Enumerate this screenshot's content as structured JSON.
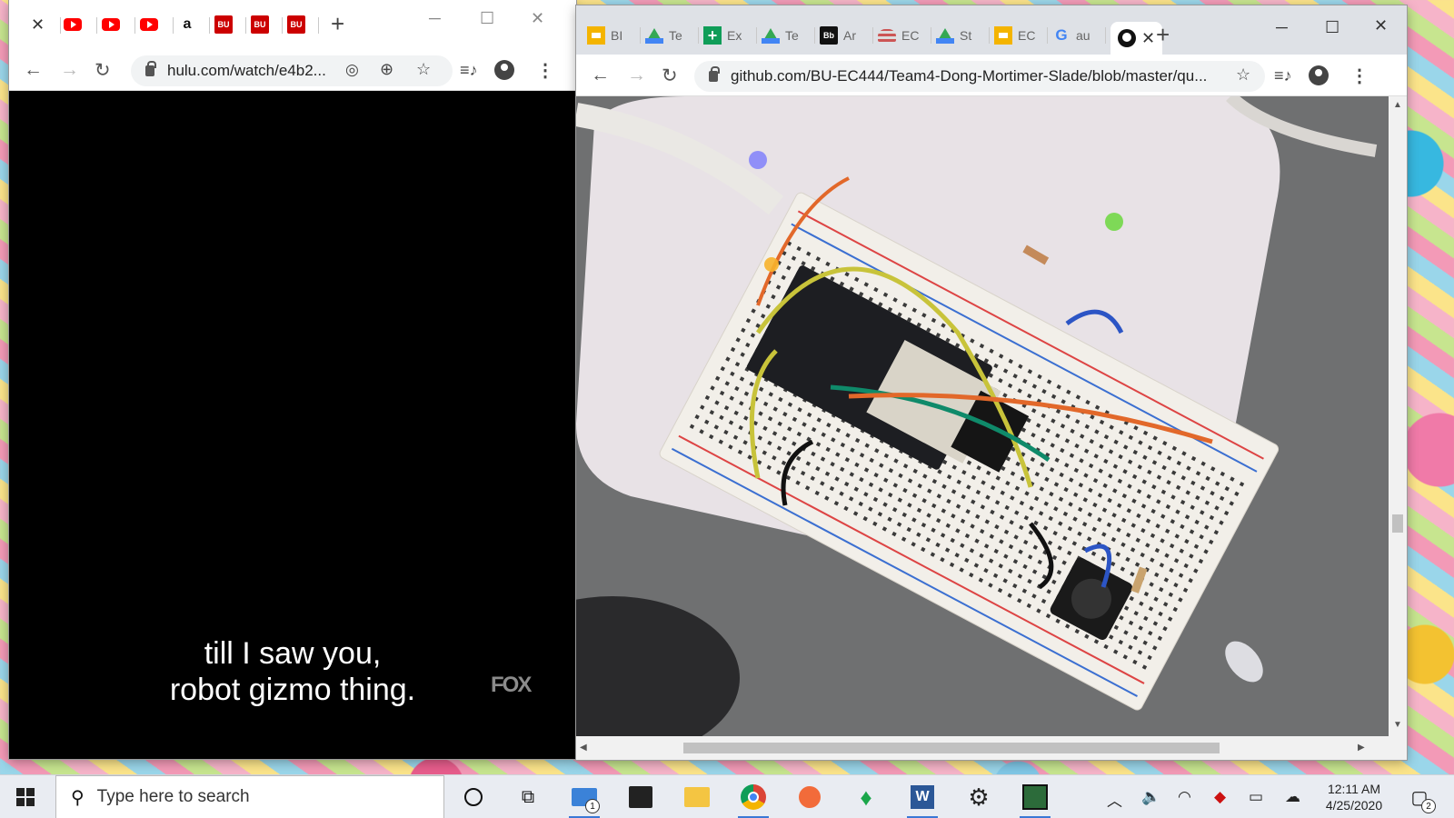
{
  "left_window": {
    "tabs": [
      {
        "icon": "close-icon",
        "kind": "close",
        "title": ""
      },
      {
        "icon": "youtube-icon",
        "kind": "yt",
        "title": ""
      },
      {
        "icon": "youtube-icon",
        "kind": "yt",
        "title": ""
      },
      {
        "icon": "youtube-icon",
        "kind": "yt",
        "title": ""
      },
      {
        "icon": "amazon-icon",
        "kind": "az",
        "title": ""
      },
      {
        "icon": "bu-icon",
        "kind": "bu",
        "title": ""
      },
      {
        "icon": "bu-icon",
        "kind": "bu",
        "title": ""
      },
      {
        "icon": "bu-icon",
        "kind": "bu",
        "title": ""
      }
    ],
    "url": "hulu.com/watch/e4b2...",
    "caption_line1": "till I saw you,",
    "caption_line2": "robot gizmo thing.",
    "logo_text": "FOX"
  },
  "right_window": {
    "tabs": [
      {
        "icon": "slides-icon",
        "kind": "slides",
        "title": "BІ"
      },
      {
        "icon": "drive-icon",
        "kind": "drive",
        "title": "Te"
      },
      {
        "icon": "sheets-icon",
        "kind": "sheets",
        "title": "Ex"
      },
      {
        "icon": "drive-icon",
        "kind": "drive",
        "title": "Te"
      },
      {
        "icon": "blackboard-icon",
        "kind": "bb",
        "title": "Ar"
      },
      {
        "icon": "ec-icon",
        "kind": "ec",
        "title": "EC"
      },
      {
        "icon": "drive-icon",
        "kind": "drive",
        "title": "St"
      },
      {
        "icon": "slides-icon",
        "kind": "slides",
        "title": "EC"
      },
      {
        "icon": "google-icon",
        "kind": "g",
        "title": "au"
      },
      {
        "icon": "github-icon",
        "kind": "gh",
        "title": ""
      }
    ],
    "url": "github.com/BU-EC444/Team4-Dong-Mortimer-Slade/blob/master/qu..."
  },
  "taskbar": {
    "search_placeholder": "Type here to search",
    "mail_badge": "1",
    "time": "12:11 AM",
    "date": "4/25/2020",
    "notifications_badge": "2"
  },
  "colors": {
    "accent": "#3a78d6",
    "youtube": "#ff0000",
    "bu": "#cc0000"
  }
}
